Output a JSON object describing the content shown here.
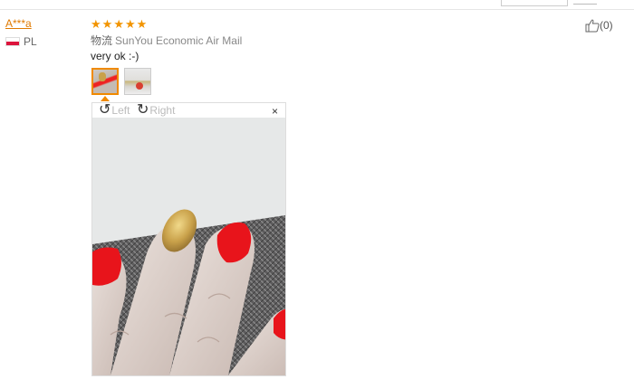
{
  "review": {
    "username": "A***a",
    "country_code": "PL",
    "rating": 5,
    "shipping_label": "物流",
    "shipping_method": "SunYou Economic Air Mail",
    "feedback_text": "very ok :-)",
    "helpful_count": "(0)"
  },
  "viewer": {
    "rotate_left_label": "Left",
    "rotate_right_label": "Right",
    "close_symbol": "×"
  },
  "icons": {
    "thumbs_up": "thumbs-up-icon",
    "rotate_left": "rotate-left-icon",
    "rotate_right": "rotate-right-icon",
    "star": "star-icon"
  },
  "colors": {
    "username": "#e07a00",
    "star": "#f29400",
    "selected_thumb_border": "#f08a00",
    "nail_red": "#e8141b",
    "nail_gold": "#c9a14a"
  }
}
